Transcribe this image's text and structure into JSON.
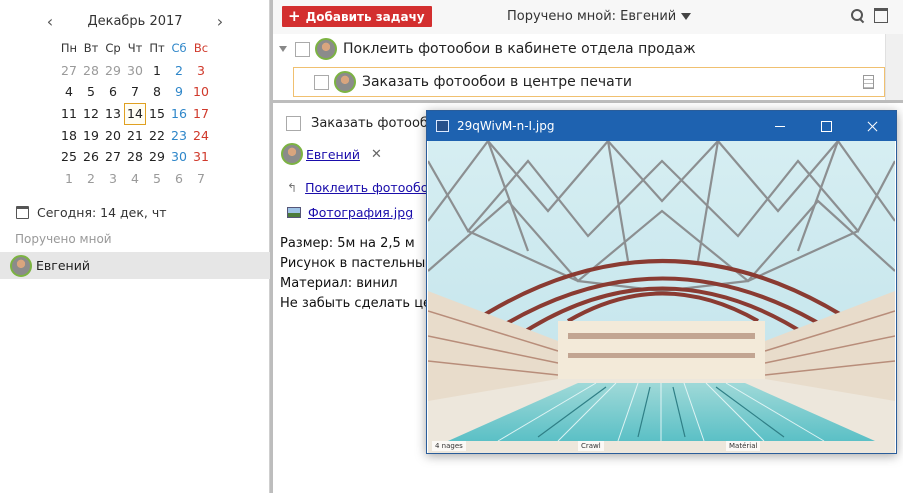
{
  "calendar": {
    "title": "Декабрь 2017",
    "prev": "‹",
    "next": "›",
    "weekdays": [
      "Пн",
      "Вт",
      "Ср",
      "Чт",
      "Пт",
      "Сб",
      "Вс"
    ],
    "weeks": [
      [
        {
          "d": "27",
          "o": true
        },
        {
          "d": "28",
          "o": true
        },
        {
          "d": "29",
          "o": true
        },
        {
          "d": "30",
          "o": true
        },
        {
          "d": "1"
        },
        {
          "d": "2"
        },
        {
          "d": "3"
        }
      ],
      [
        {
          "d": "4"
        },
        {
          "d": "5"
        },
        {
          "d": "6"
        },
        {
          "d": "7"
        },
        {
          "d": "8"
        },
        {
          "d": "9"
        },
        {
          "d": "10"
        }
      ],
      [
        {
          "d": "11"
        },
        {
          "d": "12"
        },
        {
          "d": "13"
        },
        {
          "d": "14",
          "today": true
        },
        {
          "d": "15"
        },
        {
          "d": "16"
        },
        {
          "d": "17"
        }
      ],
      [
        {
          "d": "18"
        },
        {
          "d": "19"
        },
        {
          "d": "20"
        },
        {
          "d": "21"
        },
        {
          "d": "22"
        },
        {
          "d": "23"
        },
        {
          "d": "24"
        }
      ],
      [
        {
          "d": "25"
        },
        {
          "d": "26"
        },
        {
          "d": "27"
        },
        {
          "d": "28"
        },
        {
          "d": "29"
        },
        {
          "d": "30"
        },
        {
          "d": "31"
        }
      ],
      [
        {
          "d": "1",
          "o": true
        },
        {
          "d": "2",
          "o": true
        },
        {
          "d": "3",
          "o": true
        },
        {
          "d": "4",
          "o": true
        },
        {
          "d": "5",
          "o": true
        },
        {
          "d": "6",
          "o": true
        },
        {
          "d": "7",
          "o": true
        }
      ]
    ]
  },
  "sidebar": {
    "today_label": "Сегодня: 14 дек, чт",
    "section_label": "Поручено мной",
    "user_name": "Евгений"
  },
  "toolbar": {
    "add_label": "Добавить задачу",
    "filter_label": "Поручено мной: Евгений"
  },
  "tasks": {
    "parent_title": "Поклеить фотообои в кабинете отдела продаж",
    "child_title": "Заказать фотообои в центре печати"
  },
  "detail": {
    "title": "Заказать фотообои",
    "assignee": "Евгений",
    "remove": "✕",
    "parent_link": "Поклеить фотообои",
    "attachment": "Фотография.jpg",
    "notes": [
      "Размер: 5м на 2,5 м",
      "Рисунок в пастельны",
      "Материал: винил",
      "Не забыть сделать це"
    ]
  },
  "viewer": {
    "title": "29qWivM-n-I.jpg",
    "captions": [
      "4 nages",
      "Crawl",
      "Matérial"
    ]
  },
  "colors": {
    "accent_red": "#d32f2f",
    "titlebar_blue": "#1e62b0",
    "avatar_ring": "#7cb342",
    "today_outline": "#e0a020"
  }
}
